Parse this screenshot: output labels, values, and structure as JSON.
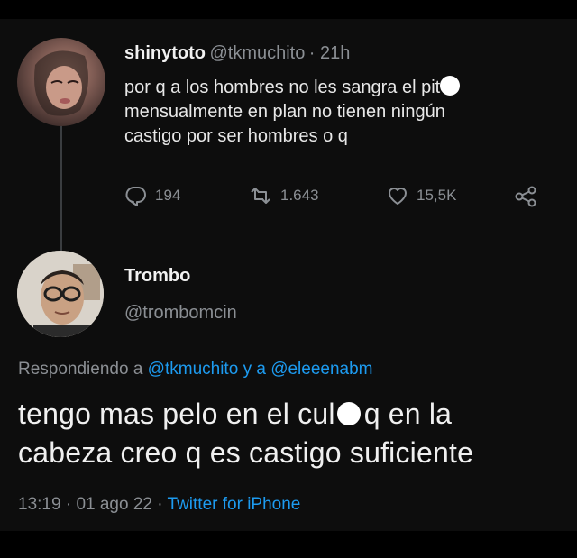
{
  "tweet1": {
    "display_name": "shinytoto",
    "handle": "@tkmuchito",
    "time": "· 21h",
    "text_line1": "por q a los hombres no les sangra el pit",
    "text_line2": "mensualmente en plan no tienen ningún",
    "text_line3": "castigo por ser hombres o q",
    "replies": "194",
    "retweets": "1.643",
    "likes": "15,5K"
  },
  "tweet2": {
    "display_name": "Trombo",
    "handle": "@trombomcin",
    "replying_prefix": "Respondiendo a",
    "replying_to1": "@tkmuchito",
    "replying_and": "y a",
    "replying_to2": "@eleeenabm",
    "text_line1a": "tengo mas pelo en el cul",
    "text_line1b": "q en la",
    "text_line2": "cabeza creo q es castigo suficiente",
    "time": "13:19",
    "date": "01 ago 22",
    "source": "Twitter for iPhone"
  },
  "icons": [
    "reply-icon",
    "retweet-icon",
    "like-icon",
    "share-icon"
  ],
  "colors": {
    "background": "#0d0d0d",
    "link": "#1d9bf0",
    "muted": "#8b8f94"
  }
}
